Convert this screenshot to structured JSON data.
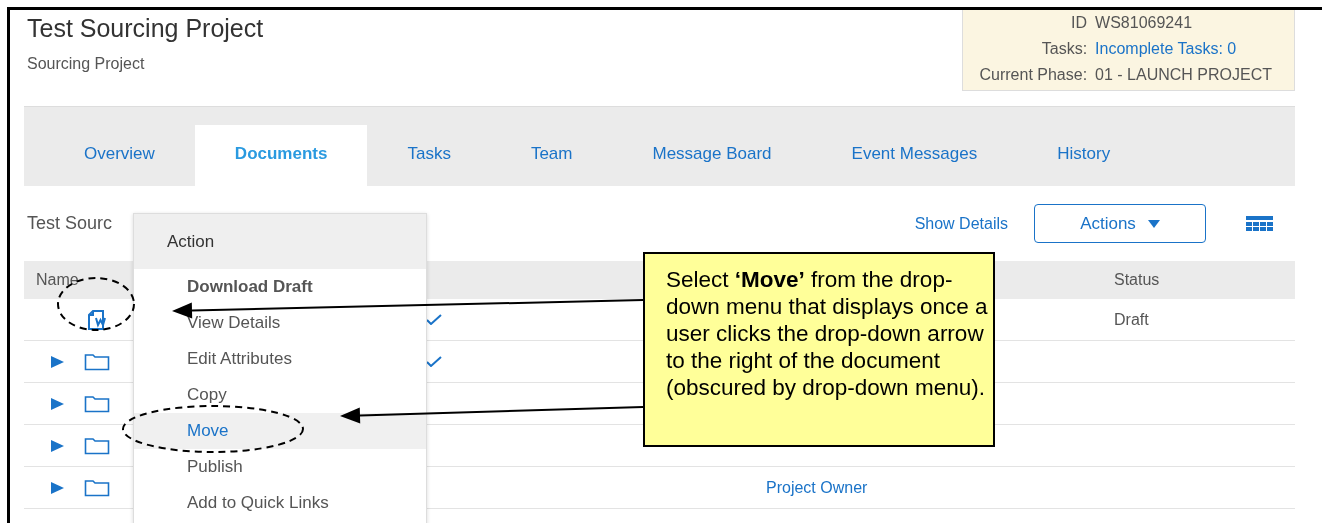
{
  "header": {
    "title": "Test Sourcing Project",
    "subtitle": "Sourcing Project"
  },
  "info": [
    {
      "label": "ID",
      "value": "WS81069241",
      "kind": "text"
    },
    {
      "label": "Tasks:",
      "value": "Incomplete Tasks: 0",
      "kind": "link"
    },
    {
      "label": "Current Phase:",
      "value": "01 - LAUNCH PROJECT",
      "kind": "text"
    }
  ],
  "tabs": [
    {
      "label": "Overview",
      "selected": false
    },
    {
      "label": "Documents",
      "selected": true
    },
    {
      "label": "Tasks",
      "selected": false
    },
    {
      "label": "Team",
      "selected": false
    },
    {
      "label": "Message Board",
      "selected": false
    },
    {
      "label": "Event Messages",
      "selected": false
    },
    {
      "label": "History",
      "selected": false
    }
  ],
  "section": {
    "title": "Test Sourc",
    "show_details": "Show Details",
    "actions": "Actions"
  },
  "table": {
    "columns": {
      "name": "Name",
      "status": "Status"
    },
    "rows": [
      {
        "kind": "document",
        "check_mark": true,
        "status": "Draft"
      },
      {
        "kind": "folder",
        "check_mark": true
      },
      {
        "kind": "folder",
        "check_mark": false
      },
      {
        "kind": "folder",
        "check_mark": false
      },
      {
        "kind": "folder",
        "check_mark": false,
        "role": "Project Owner"
      }
    ]
  },
  "menu": {
    "title": "Action",
    "items": [
      {
        "label": "Download Draft",
        "default": true,
        "selected": false
      },
      {
        "label": "View Details",
        "default": false,
        "selected": false
      },
      {
        "label": "Edit Attributes",
        "default": false,
        "selected": false
      },
      {
        "label": "Copy",
        "default": false,
        "selected": false
      },
      {
        "label": "Move",
        "default": false,
        "selected": true
      },
      {
        "label": "Publish",
        "default": false,
        "selected": false
      },
      {
        "label": "Add to Quick Links",
        "default": false,
        "selected": false
      }
    ]
  },
  "callout": {
    "text": "Select **‘Move’** from the drop-down menu that displays once a user clicks the drop-down arrow to the right of the document (obscured by drop-down menu)."
  }
}
